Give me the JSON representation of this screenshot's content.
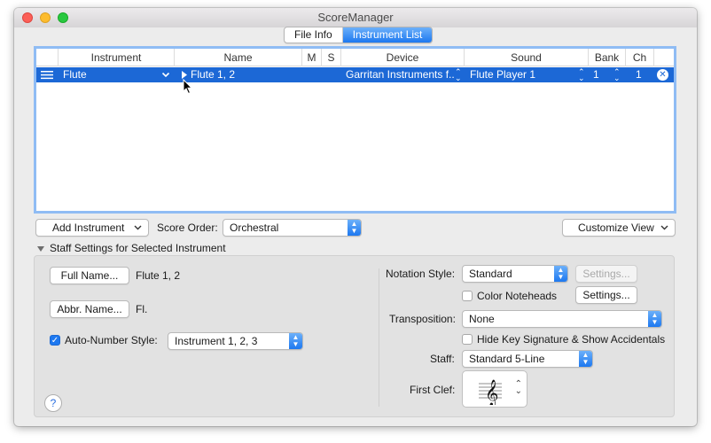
{
  "window": {
    "title": "ScoreManager"
  },
  "tabs": [
    {
      "label": "File Info",
      "selected": false
    },
    {
      "label": "Instrument List",
      "selected": true
    }
  ],
  "table": {
    "columns": [
      "Instrument",
      "Name",
      "M",
      "S",
      "Device",
      "Sound",
      "Bank",
      "Ch"
    ],
    "rows": [
      {
        "instrument": "Flute",
        "name": "Flute 1, 2",
        "device": "Garritan Instruments f...",
        "sound": "Flute Player 1",
        "bank": "1",
        "ch": "1"
      }
    ]
  },
  "controls": {
    "add_instrument": "Add Instrument",
    "score_order_label": "Score Order:",
    "score_order_value": "Orchestral",
    "customize_view": "Customize View"
  },
  "staff_settings": {
    "header": "Staff Settings for Selected Instrument",
    "full_name_button": "Full Name...",
    "full_name_value": "Flute 1, 2",
    "abbr_name_button": "Abbr. Name...",
    "abbr_name_value": "Fl.",
    "auto_number_label": "Auto-Number Style:",
    "auto_number_checked": true,
    "auto_number_value": "Instrument 1, 2, 3",
    "notation_style_label": "Notation Style:",
    "notation_style_value": "Standard",
    "settings_disabled": "Settings...",
    "color_noteheads_label": "Color Noteheads",
    "color_noteheads_checked": false,
    "settings_button": "Settings...",
    "transposition_label": "Transposition:",
    "transposition_value": "None",
    "hide_key_label": "Hide Key Signature & Show Accidentals",
    "hide_key_checked": false,
    "staff_label": "Staff:",
    "staff_value": "Standard 5-Line",
    "first_clef_label": "First Clef:",
    "help": "?"
  },
  "icons": [
    "drag-handle-icon",
    "chevron-down-icon",
    "disclosure-triangle-icon",
    "updown-arrows-icon",
    "remove-icon",
    "treble-clef-icon",
    "mouse-pointer-icon",
    "help-icon"
  ],
  "colors": {
    "accent": "#1d78f0",
    "selection": "#1c68d6",
    "focus_ring": "#8fbcf4"
  }
}
